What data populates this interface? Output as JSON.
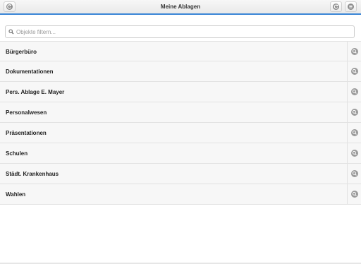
{
  "header": {
    "title": "Meine Ablagen",
    "accent_color": "#3b86d6",
    "back_icon": "back-icon",
    "refresh_icon": "refresh-icon",
    "menu_icon": "menu-icon"
  },
  "filter": {
    "placeholder": "Objekte filtern...",
    "value": "",
    "icon": "search-icon"
  },
  "list": {
    "items": [
      {
        "label": "Bürgerbüro",
        "action_icon": "search-icon"
      },
      {
        "label": "Dokumentationen",
        "action_icon": "search-icon"
      },
      {
        "label": "Pers. Ablage E. Mayer",
        "action_icon": "search-icon"
      },
      {
        "label": "Personalwesen",
        "action_icon": "search-icon"
      },
      {
        "label": "Präsentationen",
        "action_icon": "search-icon"
      },
      {
        "label": "Schulen",
        "action_icon": "search-icon"
      },
      {
        "label": "Städt. Krankenhaus",
        "action_icon": "search-icon"
      },
      {
        "label": "Wahlen",
        "action_icon": "search-icon"
      }
    ]
  }
}
